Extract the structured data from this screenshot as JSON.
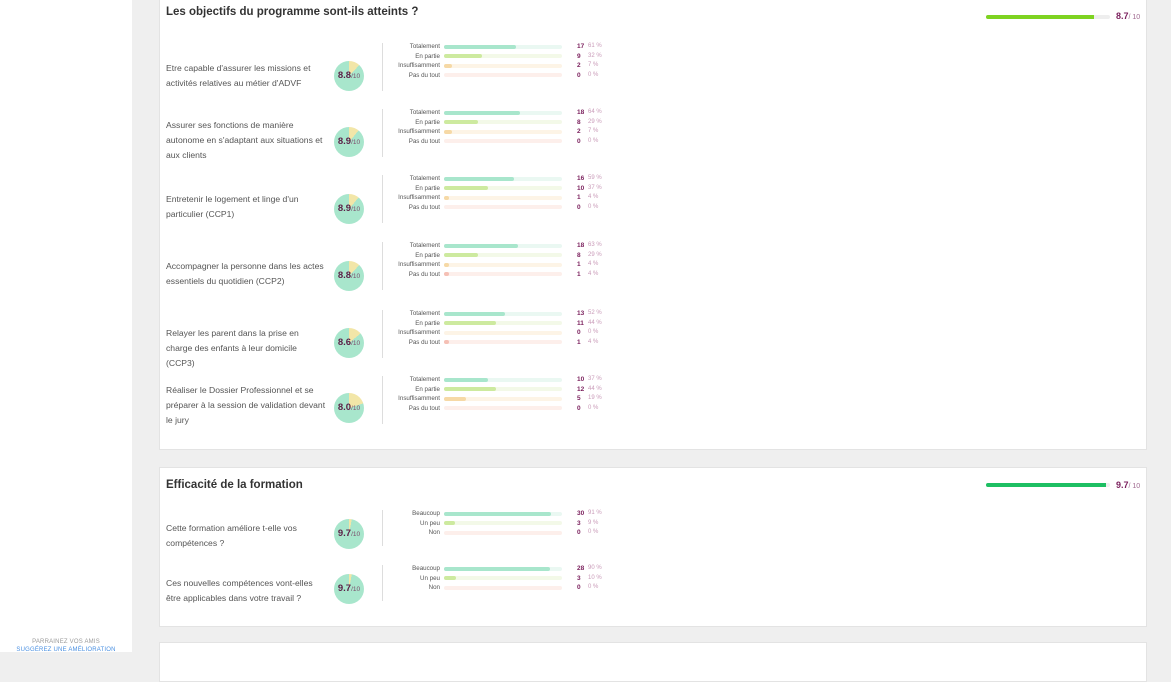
{
  "sidebar": {
    "link_referral": "PARRAINEZ VOS AMIS",
    "link_suggest": "SUGGÉREZ UNE AMÉLIORATION"
  },
  "colors": {
    "bar_green": "#7ed321",
    "bar_green2": "#1dbf63",
    "fill_totalement": "#a8e6cc",
    "track_totalement": "#eaf8f2",
    "fill_en_partie": "#cdea9f",
    "track_en_partie": "#f3f9e8",
    "fill_insuffisamment": "#f6d9a6",
    "track_insuffisamment": "#fdf4e6",
    "fill_pas": "#f5c0b5",
    "track_pas": "#fdefeb",
    "accent": "#7a1f5c"
  },
  "section1": {
    "title": "Les objectifs du programme sont-ils atteints ?",
    "score": "8.7",
    "score_den": "/ 10",
    "score_fraction": 0.87,
    "criteria": [
      {
        "label": "Etre capable d'assurer les missions et activités relatives au métier d'ADVF",
        "score": "8.8",
        "den": "/10",
        "fraction": 0.88,
        "answers": [
          {
            "label": "Totalement",
            "count": "17",
            "pct": "61 %",
            "frac": 0.61
          },
          {
            "label": "En partie",
            "count": "9",
            "pct": "32 %",
            "frac": 0.32
          },
          {
            "label": "Insuffisamment",
            "count": "2",
            "pct": "7 %",
            "frac": 0.07
          },
          {
            "label": "Pas du tout",
            "count": "0",
            "pct": "0 %",
            "frac": 0
          }
        ]
      },
      {
        "label": "Assurer ses fonctions de manière autonome en s'adaptant aux situations et aux clients",
        "score": "8.9",
        "den": "/10",
        "fraction": 0.89,
        "answers": [
          {
            "label": "Totalement",
            "count": "18",
            "pct": "64 %",
            "frac": 0.64
          },
          {
            "label": "En partie",
            "count": "8",
            "pct": "29 %",
            "frac": 0.29
          },
          {
            "label": "Insuffisamment",
            "count": "2",
            "pct": "7 %",
            "frac": 0.07
          },
          {
            "label": "Pas du tout",
            "count": "0",
            "pct": "0 %",
            "frac": 0
          }
        ]
      },
      {
        "label": "Entretenir le logement et linge d'un particulier (CCP1)",
        "score": "8.9",
        "den": "/10",
        "fraction": 0.89,
        "answers": [
          {
            "label": "Totalement",
            "count": "16",
            "pct": "59 %",
            "frac": 0.59
          },
          {
            "label": "En partie",
            "count": "10",
            "pct": "37 %",
            "frac": 0.37
          },
          {
            "label": "Insuffisamment",
            "count": "1",
            "pct": "4 %",
            "frac": 0.04
          },
          {
            "label": "Pas du tout",
            "count": "0",
            "pct": "0 %",
            "frac": 0
          }
        ]
      },
      {
        "label": "Accompagner la personne dans les actes essentiels du quotidien (CCP2)",
        "score": "8.8",
        "den": "/10",
        "fraction": 0.88,
        "answers": [
          {
            "label": "Totalement",
            "count": "18",
            "pct": "63 %",
            "frac": 0.63
          },
          {
            "label": "En partie",
            "count": "8",
            "pct": "29 %",
            "frac": 0.29
          },
          {
            "label": "Insuffisamment",
            "count": "1",
            "pct": "4 %",
            "frac": 0.04
          },
          {
            "label": "Pas du tout",
            "count": "1",
            "pct": "4 %",
            "frac": 0.04
          }
        ]
      },
      {
        "label": "Relayer les parent dans la prise en charge des enfants à leur domicile (CCP3)",
        "score": "8.6",
        "den": "/10",
        "fraction": 0.86,
        "answers": [
          {
            "label": "Totalement",
            "count": "13",
            "pct": "52 %",
            "frac": 0.52
          },
          {
            "label": "En partie",
            "count": "11",
            "pct": "44 %",
            "frac": 0.44
          },
          {
            "label": "Insuffisamment",
            "count": "0",
            "pct": "0 %",
            "frac": 0
          },
          {
            "label": "Pas du tout",
            "count": "1",
            "pct": "4 %",
            "frac": 0.04
          }
        ]
      },
      {
        "label": "Réaliser le Dossier Professionnel et se préparer à la session de validation devant le jury",
        "score": "8.0",
        "den": "/10",
        "fraction": 0.8,
        "answers": [
          {
            "label": "Totalement",
            "count": "10",
            "pct": "37 %",
            "frac": 0.37
          },
          {
            "label": "En partie",
            "count": "12",
            "pct": "44 %",
            "frac": 0.44
          },
          {
            "label": "Insuffisamment",
            "count": "5",
            "pct": "19 %",
            "frac": 0.19
          },
          {
            "label": "Pas du tout",
            "count": "0",
            "pct": "0 %",
            "frac": 0
          }
        ]
      }
    ]
  },
  "section2": {
    "title": "Efficacité de la formation",
    "score": "9.7",
    "score_den": "/ 10",
    "score_fraction": 0.97,
    "criteria": [
      {
        "label": "Cette formation améliore t-elle vos compétences ?",
        "score": "9.7",
        "den": "/10",
        "fraction": 0.97,
        "answers": [
          {
            "label": "Beaucoup",
            "count": "30",
            "pct": "91 %",
            "frac": 0.91
          },
          {
            "label": "Un peu",
            "count": "3",
            "pct": "9 %",
            "frac": 0.09
          },
          {
            "label": "Non",
            "count": "0",
            "pct": "0 %",
            "frac": 0
          }
        ]
      },
      {
        "label": "Ces nouvelles compétences vont-elles être applicables dans votre travail ?",
        "score": "9.7",
        "den": "/10",
        "fraction": 0.97,
        "answers": [
          {
            "label": "Beaucoup",
            "count": "28",
            "pct": "90 %",
            "frac": 0.9
          },
          {
            "label": "Un peu",
            "count": "3",
            "pct": "10 %",
            "frac": 0.1
          },
          {
            "label": "Non",
            "count": "0",
            "pct": "0 %",
            "frac": 0
          }
        ]
      }
    ]
  }
}
